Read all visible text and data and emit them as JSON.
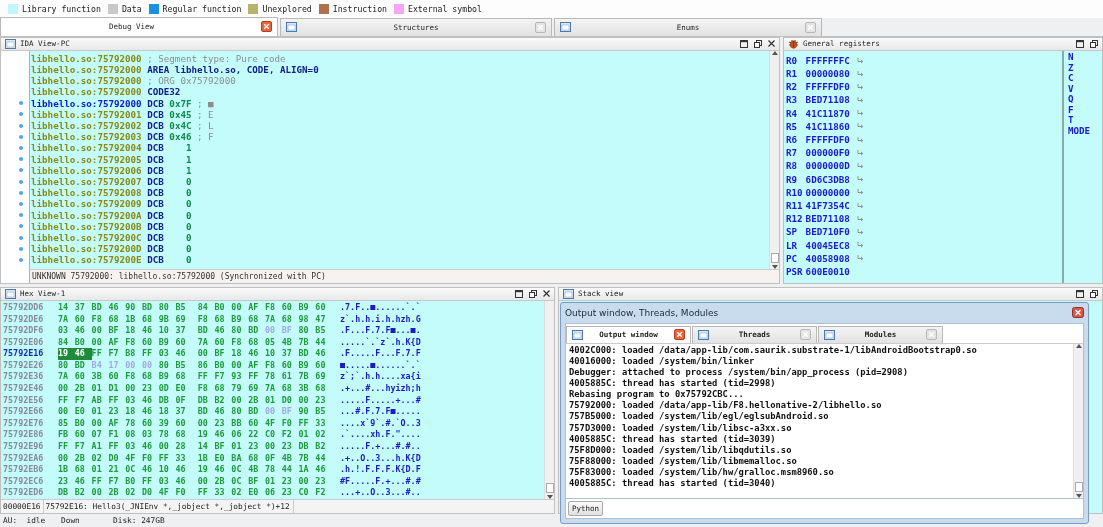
{
  "legend": [
    {
      "label": "Library function",
      "color": "#bff7fb"
    },
    {
      "label": "Data",
      "color": "#c8c8c8"
    },
    {
      "label": "Regular function",
      "color": "#1e90e0"
    },
    {
      "label": "Unexplored",
      "color": "#b4b46e"
    },
    {
      "label": "Instruction",
      "color": "#b0704e"
    },
    {
      "label": "External symbol",
      "color": "#f6a6f2"
    }
  ],
  "tabs": [
    {
      "label": "Debug View",
      "selected": true
    },
    {
      "label": "Structures",
      "selected": false
    },
    {
      "label": "Enums",
      "selected": false
    }
  ],
  "ida_view": {
    "title": "IDA View-PC",
    "lines": [
      {
        "kind": "comment",
        "address": "libhello.so:75792000",
        "text": "; Segment type: Pure code",
        "marked": false,
        "current": false
      },
      {
        "kind": "directive",
        "address": "libhello.so:75792000",
        "text": "AREA libhello.so, CODE, ALIGN=0",
        "marked": false,
        "current": false
      },
      {
        "kind": "comment",
        "address": "libhello.so:75792000",
        "text": "; ORG 0x75792000",
        "marked": false,
        "current": false
      },
      {
        "kind": "directive",
        "address": "libhello.so:75792000",
        "text": "CODE32",
        "marked": false,
        "current": false
      },
      {
        "kind": "data",
        "address": "libhello.so:75792000",
        "mnemonic": "DCB",
        "operand": "0x7F",
        "comment": "; ■",
        "marked": true,
        "current": true
      },
      {
        "kind": "data",
        "address": "libhello.so:75792001",
        "mnemonic": "DCB",
        "operand": "0x45",
        "comment": "; E",
        "marked": true,
        "current": false
      },
      {
        "kind": "data",
        "address": "libhello.so:75792002",
        "mnemonic": "DCB",
        "operand": "0x4C",
        "comment": "; L",
        "marked": true,
        "current": false
      },
      {
        "kind": "data",
        "address": "libhello.so:75792003",
        "mnemonic": "DCB",
        "operand": "0x46",
        "comment": "; F",
        "marked": true,
        "current": false
      },
      {
        "kind": "data",
        "address": "libhello.so:75792004",
        "mnemonic": "DCB",
        "operand": "1",
        "marked": true,
        "current": false
      },
      {
        "kind": "data",
        "address": "libhello.so:75792005",
        "mnemonic": "DCB",
        "operand": "1",
        "marked": true,
        "current": false
      },
      {
        "kind": "data",
        "address": "libhello.so:75792006",
        "mnemonic": "DCB",
        "operand": "1",
        "marked": true,
        "current": false
      },
      {
        "kind": "data",
        "address": "libhello.so:75792007",
        "mnemonic": "DCB",
        "operand": "0",
        "marked": true,
        "current": false
      },
      {
        "kind": "data",
        "address": "libhello.so:75792008",
        "mnemonic": "DCB",
        "operand": "0",
        "marked": true,
        "current": false
      },
      {
        "kind": "data",
        "address": "libhello.so:75792009",
        "mnemonic": "DCB",
        "operand": "0",
        "marked": true,
        "current": false
      },
      {
        "kind": "data",
        "address": "libhello.so:7579200A",
        "mnemonic": "DCB",
        "operand": "0",
        "marked": true,
        "current": false
      },
      {
        "kind": "data",
        "address": "libhello.so:7579200B",
        "mnemonic": "DCB",
        "operand": "0",
        "marked": true,
        "current": false
      },
      {
        "kind": "data",
        "address": "libhello.so:7579200C",
        "mnemonic": "DCB",
        "operand": "0",
        "marked": true,
        "current": false
      },
      {
        "kind": "data",
        "address": "libhello.so:7579200D",
        "mnemonic": "DCB",
        "operand": "0",
        "marked": true,
        "current": false
      },
      {
        "kind": "data",
        "address": "libhello.so:7579200E",
        "mnemonic": "DCB",
        "operand": "0",
        "marked": true,
        "current": false
      }
    ],
    "status": "UNKNOWN 75792000: libhello.so:75792000 (Synchronized with PC)"
  },
  "registers": {
    "title": "General registers",
    "items": [
      {
        "name": "R0",
        "value": "FFFFFFFC",
        "jump_arrow": true
      },
      {
        "name": "R1",
        "value": "00000080",
        "jump_arrow": true
      },
      {
        "name": "R2",
        "value": "FFFFFDF0",
        "jump_arrow": true
      },
      {
        "name": "R3",
        "value": "BED71108",
        "jump_arrow": true
      },
      {
        "name": "R4",
        "value": "41C11870",
        "jump_arrow": true
      },
      {
        "name": "R5",
        "value": "41C11860",
        "jump_arrow": true
      },
      {
        "name": "R6",
        "value": "FFFFFDF0",
        "jump_arrow": true
      },
      {
        "name": "R7",
        "value": "000000F0",
        "jump_arrow": true
      },
      {
        "name": "R8",
        "value": "0000000D",
        "jump_arrow": true
      },
      {
        "name": "R9",
        "value": "6D6C3DB8",
        "jump_arrow": true
      },
      {
        "name": "R10",
        "value": "00000000",
        "jump_arrow": true
      },
      {
        "name": "R11",
        "value": "41F7354C",
        "jump_arrow": true
      },
      {
        "name": "R12",
        "value": "BED71108",
        "jump_arrow": true
      },
      {
        "name": "SP",
        "value": "BED710F0",
        "jump_arrow": true
      },
      {
        "name": "LR",
        "value": "40045EC8",
        "jump_arrow": true
      },
      {
        "name": "PC",
        "value": "40058908",
        "jump_arrow": true
      },
      {
        "name": "PSR",
        "value": "600E0010",
        "jump_arrow": false
      }
    ],
    "flags": [
      "N",
      "Z",
      "C",
      "V",
      "Q",
      "F",
      "T",
      "MODE"
    ]
  },
  "hex_view": {
    "title": "Hex View-1",
    "rows": [
      {
        "address": "75792DD6",
        "current": false,
        "segments": [
          {
            "bytes": "14 37 BD 46 90 BD 80 B5 84 B0 00 AF F8 60 B9 60",
            "selected": false,
            "dim": false
          }
        ],
        "ascii": ".7.F..■......`.`"
      },
      {
        "address": "75792DE6",
        "current": false,
        "segments": [
          {
            "bytes": "7A 60 F8 68 1B 68 9B 69 F8 68 B9 68 7A 68 98 47",
            "selected": false,
            "dim": false
          }
        ],
        "ascii": "z`.h.h.i.h.hzh.G"
      },
      {
        "address": "75792DF6",
        "current": false,
        "segments": [
          {
            "bytes": "03 46 00 BF 18 46 10 37 BD 46 80 BD",
            "selected": false,
            "dim": false
          },
          {
            "bytes": "00 BF",
            "selected": false,
            "dim": true
          },
          {
            "bytes": "80 B5",
            "selected": false,
            "dim": false
          }
        ],
        "ascii": ".F...F.7.F■...■."
      },
      {
        "address": "75792E06",
        "current": false,
        "segments": [
          {
            "bytes": "84 B0 00 AF F8 60 B9 60 7A 60 F8 68 05 4B 7B 44",
            "selected": false,
            "dim": false
          }
        ],
        "ascii": ".....`.`z`.h.K{D"
      },
      {
        "address": "75792E16",
        "current": true,
        "segments": [
          {
            "bytes": "19 46",
            "selected": true,
            "dim": false
          },
          {
            "bytes": "FF F7 B8 FF 03 46 00 BF 18 46 10 37 BD 46",
            "selected": false,
            "dim": false
          }
        ],
        "ascii": ".F.....F...F.7.F"
      },
      {
        "address": "75792E26",
        "current": false,
        "segments": [
          {
            "bytes": "80 BD",
            "selected": false,
            "dim": false
          },
          {
            "bytes": "B4 17 00 00",
            "selected": false,
            "dim": true
          },
          {
            "bytes": "80 B5 86 B0 00 AF F8 60 B9 60",
            "selected": false,
            "dim": false
          }
        ],
        "ascii": "■.....■......`.`"
      },
      {
        "address": "75792E36",
        "current": false,
        "segments": [
          {
            "bytes": "7A 60 3B 60 F8 68 B9 68 FF F7 93 FF 78 61 7B 69",
            "selected": false,
            "dim": false
          }
        ],
        "ascii": "z`;`.h.h....xa{i"
      },
      {
        "address": "75792E46",
        "current": false,
        "segments": [
          {
            "bytes": "00 2B 01 D1 00 23 0D E0 F8 68 79 69 7A 68 3B 68",
            "selected": false,
            "dim": false
          }
        ],
        "ascii": ".+...#...hyizh;h"
      },
      {
        "address": "75792E56",
        "current": false,
        "segments": [
          {
            "bytes": "FF F7 AB FF 03 46 DB 0F DB B2 00 2B 01 D0 00 23",
            "selected": false,
            "dim": false
          }
        ],
        "ascii": ".....F.....+...#"
      },
      {
        "address": "75792E66",
        "current": false,
        "segments": [
          {
            "bytes": "00 E0 01 23 18 46 18 37 BD 46 80 BD",
            "selected": false,
            "dim": false
          },
          {
            "bytes": "00 BF",
            "selected": false,
            "dim": true
          },
          {
            "bytes": "90 B5",
            "selected": false,
            "dim": false
          }
        ],
        "ascii": "...#.F.7.F■....."
      },
      {
        "address": "75792E76",
        "current": false,
        "segments": [
          {
            "bytes": "85 B0 00 AF 78 60 39 60 00 23 BB 60 4F F0 FF 33",
            "selected": false,
            "dim": false
          }
        ],
        "ascii": "....x`9`.#.`O..3"
      },
      {
        "address": "75792E86",
        "current": false,
        "segments": [
          {
            "bytes": "FB 60 07 F1 08 03 78 68 19 46 06 22 C0 F2 01 02",
            "selected": false,
            "dim": false
          }
        ],
        "ascii": ".`....xh.F.\"...."
      },
      {
        "address": "75792E96",
        "current": false,
        "segments": [
          {
            "bytes": "FF F7 A1 FF 03 46 00 28 14 BF 01 23 00 23 DB B2",
            "selected": false,
            "dim": false
          }
        ],
        "ascii": ".....F.+...#.#.."
      },
      {
        "address": "75792EA6",
        "current": false,
        "segments": [
          {
            "bytes": "00 2B 02 D0 4F F0 FF 33 1B E0 BA 68 0F 4B 7B 44",
            "selected": false,
            "dim": false
          }
        ],
        "ascii": ".+..O..3...h.K{D"
      },
      {
        "address": "75792EB6",
        "current": false,
        "segments": [
          {
            "bytes": "1B 68 01 21 0C 46 10 46 19 46 0C 4B 78 44 1A 46",
            "selected": false,
            "dim": false
          }
        ],
        "ascii": ".h.!.F.F.F.K{D.F"
      },
      {
        "address": "75792EC6",
        "current": false,
        "segments": [
          {
            "bytes": "23 46 FF F7 B0 FF 03 46 00 2B 0C BF 01 23 00 23",
            "selected": false,
            "dim": false
          }
        ],
        "ascii": "#F.....F.+...#.#"
      },
      {
        "address": "75792ED6",
        "current": false,
        "segments": [
          {
            "bytes": "DB B2 00 2B 02 D0 4F F0 FF 33 02 E0 06 23 C0 F2",
            "selected": false,
            "dim": false
          }
        ],
        "ascii": "...+..O..3...#.."
      }
    ],
    "status_offset": "00000E16",
    "status_location": "75792E16: Hello3(_JNIEnv *,_jobject *,_jobject *)+12"
  },
  "stack_view": {
    "title": "Stack view"
  },
  "output": {
    "title": "Output window, Threads, Modules",
    "tabs": [
      {
        "label": "Output window",
        "selected": true
      },
      {
        "label": "Threads",
        "selected": false
      },
      {
        "label": "Modules",
        "selected": false
      }
    ],
    "lines": [
      "4002C000: loaded /data/app-lib/com.saurik.substrate-1/libAndroidBootstrap0.so",
      "40016000: loaded /system/bin/linker",
      "Debugger: attached to process /system/bin/app_process (pid=2908)",
      "4005885C: thread has started (tid=2998)",
      "Rebasing program to 0x75792CBC...",
      "75792000: loaded /data/app-lib/F8.hellonative-2/libhello.so",
      "757B5000: loaded /system/lib/egl/eglsubAndroid.so",
      "757D3000: loaded /system/lib/libsc-a3xx.so",
      "4005885C: thread has started (tid=3039)",
      "75F8D000: loaded /system/lib/libqdutils.so",
      "75F88000: loaded /system/lib/libmemalloc.so",
      "75F83000: loaded /system/lib/hw/gralloc.msm8960.so",
      "4005885C: thread has started (tid=3040)"
    ],
    "button": "Python"
  },
  "status_bar": [
    "AU:  idle",
    "Down",
    "Disk: 247GB"
  ]
}
